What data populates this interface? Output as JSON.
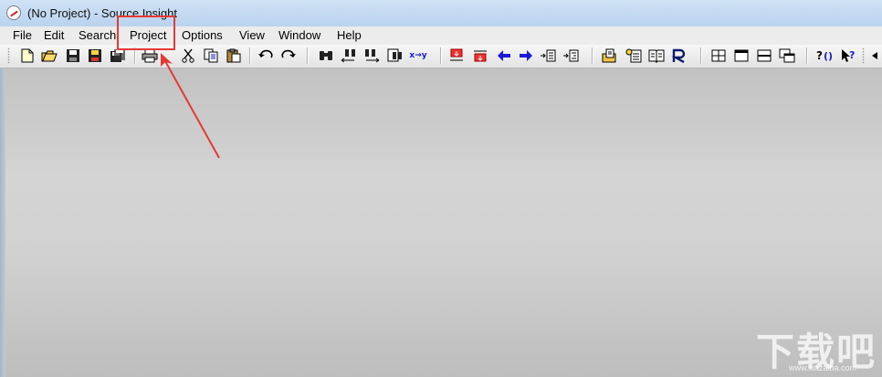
{
  "window": {
    "title": "(No Project) - Source Insight"
  },
  "menubar": {
    "items": [
      {
        "id": "file",
        "label": "File"
      },
      {
        "id": "edit",
        "label": "Edit"
      },
      {
        "id": "search",
        "label": "Search"
      },
      {
        "id": "project",
        "label": "Project"
      },
      {
        "id": "options",
        "label": "Options"
      },
      {
        "id": "view",
        "label": "View"
      },
      {
        "id": "window",
        "label": "Window"
      },
      {
        "id": "help",
        "label": "Help"
      }
    ]
  },
  "toolbar": {
    "replace_button_text": "x→y",
    "icons": [
      "new-file-icon",
      "open-folder-icon",
      "save-icon",
      "save-all-icon",
      "save-as-icon",
      "print-icon",
      "cut-icon",
      "copy-icon",
      "paste-icon",
      "undo-icon",
      "redo-icon",
      "find-icon",
      "find-prev-icon",
      "find-next-icon",
      "search-files-icon",
      "replace-icon",
      "bookmark-up-icon",
      "bookmark-down-icon",
      "back-arrow-icon",
      "forward-arrow-icon",
      "indent-left-icon",
      "indent-right-icon",
      "symbol-lookup-icon",
      "context-icon",
      "browse-icon",
      "relation-icon",
      "tile-icon",
      "horizontal-split-icon",
      "vertical-split-icon",
      "cascade-icon",
      "help-context-icon",
      "help-pointer-icon"
    ]
  },
  "annotation": {
    "highlight_color": "#e53935",
    "target": "project"
  },
  "watermark": {
    "text": "下载吧",
    "url": "www.xiazaiba.com"
  },
  "colors": {
    "titlebar": "#c4daf1",
    "menubar": "#ececec",
    "workspace": "#d0d0d0",
    "arrow_blue": "#1b1bd6"
  }
}
